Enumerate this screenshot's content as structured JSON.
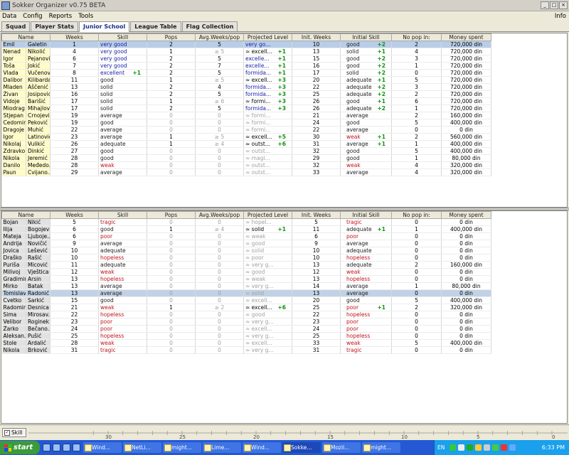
{
  "window": {
    "title": "Sokker Organizer v0.75 BETA"
  },
  "menu": {
    "items": [
      "Data",
      "Config",
      "Reports",
      "Tools"
    ],
    "right": "Info"
  },
  "tabs": [
    {
      "label": "Squad",
      "active": false
    },
    {
      "label": "Player Stats",
      "active": false
    },
    {
      "label": "Junior School",
      "active": true
    },
    {
      "label": "League Table",
      "active": false
    },
    {
      "label": "Flag Collection",
      "active": false
    }
  ],
  "columns": [
    "Name",
    "Weeks",
    "Skill",
    "Pops",
    "Avg.Weeks/pop",
    "Projected Level",
    "Init. Weeks",
    "Initial Skill",
    "No pop in:",
    "Money spent"
  ],
  "top_rows": [
    [
      "Emil",
      "Galetin",
      "1",
      "very good",
      "",
      "2",
      "5",
      "very go...",
      "",
      "10",
      "good",
      "+2",
      "2",
      "720,000 din"
    ],
    [
      "Nenad",
      "Nikolić",
      "4",
      "very good",
      "",
      "1",
      "≥ 5",
      "≈ excell...",
      "+1",
      "13",
      "solid",
      "+1",
      "4",
      "720,000 din"
    ],
    [
      "Igor",
      "Pejanović",
      "6",
      "very good",
      "",
      "2",
      "5",
      "excelle...",
      "+1",
      "15",
      "good",
      "+2",
      "3",
      "720,000 din"
    ],
    [
      "Toša",
      "Jokić",
      "7",
      "very good",
      "",
      "2",
      "7",
      "excelle...",
      "+1",
      "16",
      "good",
      "+2",
      "1",
      "720,000 din"
    ],
    [
      "Vlada",
      "Vučenov",
      "8",
      "excellent",
      "+1",
      "2",
      "5",
      "formida...",
      "+1",
      "17",
      "solid",
      "+2",
      "0",
      "720,000 din"
    ],
    [
      "Dalibor",
      "Kilibarda",
      "11",
      "good",
      "",
      "1",
      "≥ 5",
      "≈ excell...",
      "+3",
      "20",
      "adequate",
      "+1",
      "5",
      "720,000 din"
    ],
    [
      "Mladen",
      "Aščenić",
      "13",
      "solid",
      "",
      "2",
      "4",
      "formida...",
      "+3",
      "22",
      "adequate",
      "+2",
      "3",
      "720,000 din"
    ],
    [
      "Živan",
      "Josipović",
      "16",
      "solid",
      "",
      "2",
      "5",
      "formida...",
      "+3",
      "25",
      "adequate",
      "+2",
      "2",
      "720,000 din"
    ],
    [
      "Vidoje",
      "Barišić",
      "17",
      "solid",
      "",
      "1",
      "≥ 6",
      "≈ formi...",
      "+3",
      "26",
      "good",
      "+1",
      "6",
      "720,000 din"
    ],
    [
      "Miodrag",
      "Mihajlović",
      "17",
      "solid",
      "",
      "2",
      "5",
      "formida...",
      "+3",
      "26",
      "adequate",
      "+2",
      "1",
      "720,000 din"
    ],
    [
      "Stjepan",
      "Crnojević",
      "19",
      "average",
      "",
      "0",
      "0",
      "≈ formi...",
      "",
      "21",
      "average",
      "",
      "2",
      "160,000 din"
    ],
    [
      "Cedomir",
      "Peković",
      "19",
      "good",
      "",
      "0",
      "0",
      "≈ formi...",
      "",
      "24",
      "good",
      "",
      "5",
      "400,000 din"
    ],
    [
      "Dragoje",
      "Muhić",
      "22",
      "average",
      "",
      "0",
      "0",
      "≈ formi...",
      "",
      "22",
      "average",
      "",
      "0",
      "0 din"
    ],
    [
      "Igor",
      "Latinović",
      "23",
      "average",
      "",
      "1",
      "≥ 5",
      "≈ excell...",
      "+5",
      "30",
      "weak",
      "+1",
      "2",
      "560,000 din"
    ],
    [
      "Nikolaj",
      "Vulikić",
      "26",
      "adequate",
      "",
      "1",
      "≥ 4",
      "≈ outst...",
      "+6",
      "31",
      "average",
      "+1",
      "1",
      "400,000 din"
    ],
    [
      "Zdravko",
      "Dinkić",
      "27",
      "good",
      "",
      "0",
      "0",
      "≈ outst...",
      "",
      "32",
      "good",
      "",
      "5",
      "400,000 din"
    ],
    [
      "Nikola",
      "Jeremić",
      "28",
      "good",
      "",
      "0",
      "0",
      "≈ magi...",
      "",
      "29",
      "good",
      "",
      "1",
      "80,000 din"
    ],
    [
      "Danilo",
      "Međedo...",
      "28",
      "weak",
      "",
      "0",
      "0",
      "≈ outst...",
      "",
      "32",
      "weak",
      "",
      "4",
      "320,000 din"
    ],
    [
      "Paun",
      "Cvijano...",
      "29",
      "average",
      "",
      "0",
      "0",
      "≈ outst...",
      "",
      "33",
      "average",
      "",
      "4",
      "320,000 din"
    ]
  ],
  "bottom_rows": [
    [
      "Bojan",
      "Nikić",
      "5",
      "tragic",
      "",
      "0",
      "0",
      "≈ hopel...",
      "",
      "5",
      "tragic",
      "",
      "0",
      "0 din"
    ],
    [
      "Ilija",
      "Bogojević",
      "6",
      "good",
      "",
      "1",
      "≥ 4",
      "≈ solid",
      "+1",
      "11",
      "adequate",
      "+1",
      "1",
      "400,000 din"
    ],
    [
      "Mateja",
      "Ljuboje...",
      "6",
      "poor",
      "",
      "0",
      "0",
      "≈ weak",
      "",
      "6",
      "poor",
      "",
      "0",
      "0 din"
    ],
    [
      "Andrija",
      "Novičić",
      "9",
      "average",
      "",
      "0",
      "0",
      "≈ good",
      "",
      "9",
      "average",
      "",
      "0",
      "0 din"
    ],
    [
      "Jovica",
      "Lešević",
      "10",
      "adequate",
      "",
      "0",
      "0",
      "≈ solid",
      "",
      "10",
      "adequate",
      "",
      "0",
      "0 din"
    ],
    [
      "Draško",
      "Rašić",
      "10",
      "hopeless",
      "",
      "0",
      "0",
      "≈ poor",
      "",
      "10",
      "hopeless",
      "",
      "0",
      "0 din"
    ],
    [
      "Puriša",
      "Micović",
      "11",
      "adequate",
      "",
      "0",
      "0",
      "≈ very g...",
      "",
      "13",
      "adequate",
      "",
      "2",
      "160,000 din"
    ],
    [
      "Milivoj",
      "Vještica",
      "12",
      "weak",
      "",
      "0",
      "0",
      "≈ good",
      "",
      "12",
      "weak",
      "",
      "0",
      "0 din"
    ],
    [
      "Gradimir",
      "Arsin",
      "13",
      "hopeless",
      "",
      "0",
      "0",
      "≈ weak",
      "",
      "13",
      "hopeless",
      "",
      "0",
      "0 din"
    ],
    [
      "Mirko",
      "Batak",
      "13",
      "average",
      "",
      "0",
      "0",
      "≈ very g...",
      "",
      "14",
      "average",
      "",
      "1",
      "80,000 din"
    ],
    [
      "Tomislav",
      "Radonić",
      "13",
      "average",
      "",
      "0",
      "0",
      "≈ solid",
      "",
      "13",
      "average",
      "",
      "0",
      "0 din"
    ],
    [
      "Cvetko",
      "Sarkić",
      "15",
      "good",
      "",
      "0",
      "0",
      "≈ excell...",
      "",
      "20",
      "good",
      "",
      "5",
      "400,000 din"
    ],
    [
      "Radomir",
      "Desnica",
      "21",
      "weak",
      "",
      "1",
      "≥ 2",
      "≈ excell...",
      "+6",
      "25",
      "poor",
      "+1",
      "2",
      "320,000 din"
    ],
    [
      "Sima",
      "Mirosav...",
      "22",
      "hopeless",
      "",
      "0",
      "0",
      "≈ good",
      "",
      "22",
      "hopeless",
      "",
      "0",
      "0 din"
    ],
    [
      "Velibor",
      "Roginek",
      "23",
      "poor",
      "",
      "0",
      "0",
      "≈ very g...",
      "",
      "23",
      "poor",
      "",
      "0",
      "0 din"
    ],
    [
      "Žarko",
      "Bečano...",
      "24",
      "poor",
      "",
      "0",
      "0",
      "≈ excell...",
      "",
      "24",
      "poor",
      "",
      "0",
      "0 din"
    ],
    [
      "Aleksan...",
      "Pušić",
      "25",
      "hopeless",
      "",
      "0",
      "0",
      "≈ very g...",
      "",
      "25",
      "hopeless",
      "",
      "0",
      "0 din"
    ],
    [
      "Stole",
      "Ardalić",
      "28",
      "weak",
      "",
      "0",
      "0",
      "≈ excell...",
      "",
      "33",
      "weak",
      "",
      "5",
      "400,000 din"
    ],
    [
      "Nikola",
      "Brković",
      "31",
      "tragic",
      "",
      "0",
      "0",
      "≈ very g...",
      "",
      "31",
      "tragic",
      "",
      "0",
      "0 din"
    ]
  ],
  "status": {
    "checkbox_label": "Skill",
    "ruler_labels": [
      "30",
      "25",
      "20",
      "15",
      "10",
      "5",
      "0"
    ]
  },
  "taskbar": {
    "start": "start",
    "tasks": [
      "Wind...",
      "NetLi...",
      "might...",
      "Lime...",
      "Wind...",
      "Sokke...",
      "Mozil...",
      "might..."
    ],
    "lang": "EN",
    "clock": "6:33 PM"
  }
}
